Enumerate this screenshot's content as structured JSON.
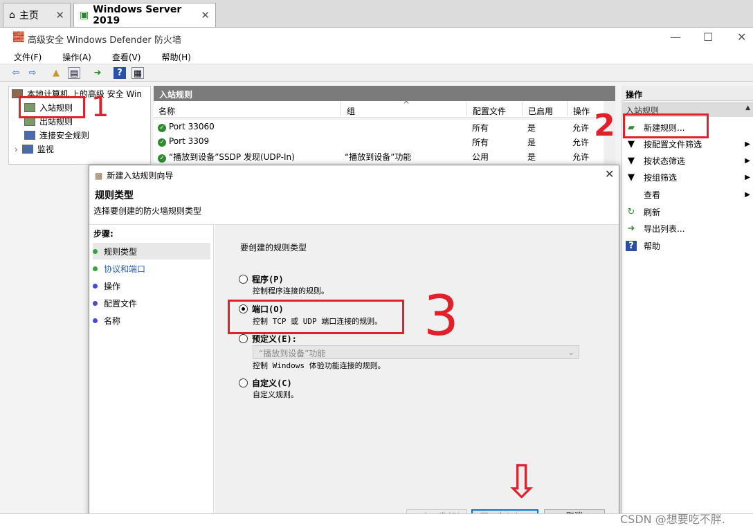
{
  "vm_tabs": [
    {
      "label": "主页"
    },
    {
      "label": "Windows Server 2019"
    }
  ],
  "window": {
    "title": "高级安全 Windows Defender 防火墙"
  },
  "menu": [
    "文件(F)",
    "操作(A)",
    "查看(V)",
    "帮助(H)"
  ],
  "tree": {
    "root": "本地计算机 上的高级 安全 Win",
    "items": [
      "入站规则",
      "出站规则",
      "连接安全规则",
      "监视"
    ]
  },
  "list": {
    "header": "入站规则",
    "columns": [
      "名称",
      "组",
      "配置文件",
      "已启用",
      "操作"
    ],
    "rows": [
      {
        "name": "Port 33060",
        "group": "",
        "profile": "所有",
        "enabled": "是",
        "action": "允许"
      },
      {
        "name": "Port 3309",
        "group": "",
        "profile": "所有",
        "enabled": "是",
        "action": "允许"
      },
      {
        "name": "“播放到设备”SSDP 发现(UDP-In)",
        "group": "“播放到设备”功能",
        "profile": "公用",
        "enabled": "是",
        "action": "允许"
      }
    ]
  },
  "actions": {
    "header": "操作",
    "section": "入站规则",
    "items": [
      {
        "label": "新建规则...",
        "icon": "new-rule-icon"
      },
      {
        "label": "按配置文件筛选",
        "icon": "filter-icon"
      },
      {
        "label": "按状态筛选",
        "icon": "filter-icon"
      },
      {
        "label": "按组筛选",
        "icon": "filter-icon"
      },
      {
        "label": "查看",
        "icon": ""
      },
      {
        "label": "刷新",
        "icon": "refresh-icon"
      },
      {
        "label": "导出列表...",
        "icon": "export-icon"
      },
      {
        "label": "帮助",
        "icon": "help-icon"
      }
    ]
  },
  "dialog": {
    "title": "新建入站规则向导",
    "heading": "规则类型",
    "subheading": "选择要创建的防火墙规则类型",
    "steps_header": "步骤:",
    "steps": [
      "规则类型",
      "协议和端口",
      "操作",
      "配置文件",
      "名称"
    ],
    "prompt": "要创建的规则类型",
    "options": [
      {
        "label": "程序(P)",
        "desc": "控制程序连接的规则。",
        "selected": false
      },
      {
        "label": "端口(O)",
        "desc": "控制 TCP 或 UDP 端口连接的规则。",
        "selected": true
      },
      {
        "label": "预定义(E):",
        "desc": "控制 Windows 体验功能连接的规则。",
        "selected": false,
        "dropdown": "“播放到设备”功能"
      },
      {
        "label": "自定义(C)",
        "desc": "自定义规则。",
        "selected": false
      }
    ],
    "buttons": {
      "back": "< 上一步(B)",
      "next": "下一步(N) >",
      "cancel": "取消"
    }
  },
  "annotations": {
    "n1": "1",
    "n2": "2",
    "n3": "3",
    "arrow": "⇩",
    "color": "#e0202a"
  },
  "watermark": "CSDN @想要吃不胖."
}
